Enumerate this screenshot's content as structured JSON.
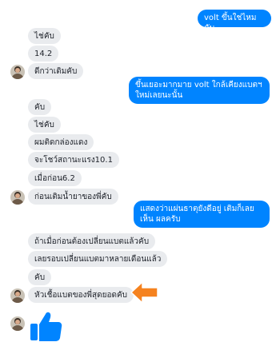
{
  "conversation": {
    "outgoing": [
      {
        "text": "volt ขึ้นใช่ไหมคับ"
      },
      {
        "text": "ขึ้นเยอะมากมาย volt ใกล้เคียงแบตฯ ใหม่เลยนะนั้น"
      },
      {
        "text": "แสดงว่าแผ่นธาตุยังดีอยู่ เติมก็เลยเห็น ผลครับ"
      }
    ],
    "incoming": [
      {
        "text": "ไช่คับ"
      },
      {
        "text": "14.2"
      },
      {
        "text": "ดีกว่าเดิมคับ"
      },
      {
        "text": "คับ"
      },
      {
        "text": "ไช่คับ"
      },
      {
        "text": "ผมติดกล่องแดง"
      },
      {
        "text": "จะโชว์สถานะแรง10.1"
      },
      {
        "text": "เมื่อก่อน6.2"
      },
      {
        "text": "ก่อนเติมน้ำยาของพี่คับ"
      },
      {
        "text": "ถ้าเมื่อก่อนต้องเปลี่ยนแบตแล้วคับ"
      },
      {
        "text": "เลยรอบเปลี่ยนแบตมาหลายเดือนแล้ว"
      },
      {
        "text": "คับ"
      },
      {
        "text": "หัวเชื้อแบตของพี่สุดยอดคับ"
      }
    ],
    "reaction": {
      "icon": "thumbs-up-icon"
    },
    "annotation": {
      "icon": "arrow-left-icon",
      "color": "#f5821f"
    }
  },
  "colors": {
    "outgoing_bubble": "#0084ff",
    "incoming_bubble": "#e9ebee",
    "like": "#0084ff"
  }
}
